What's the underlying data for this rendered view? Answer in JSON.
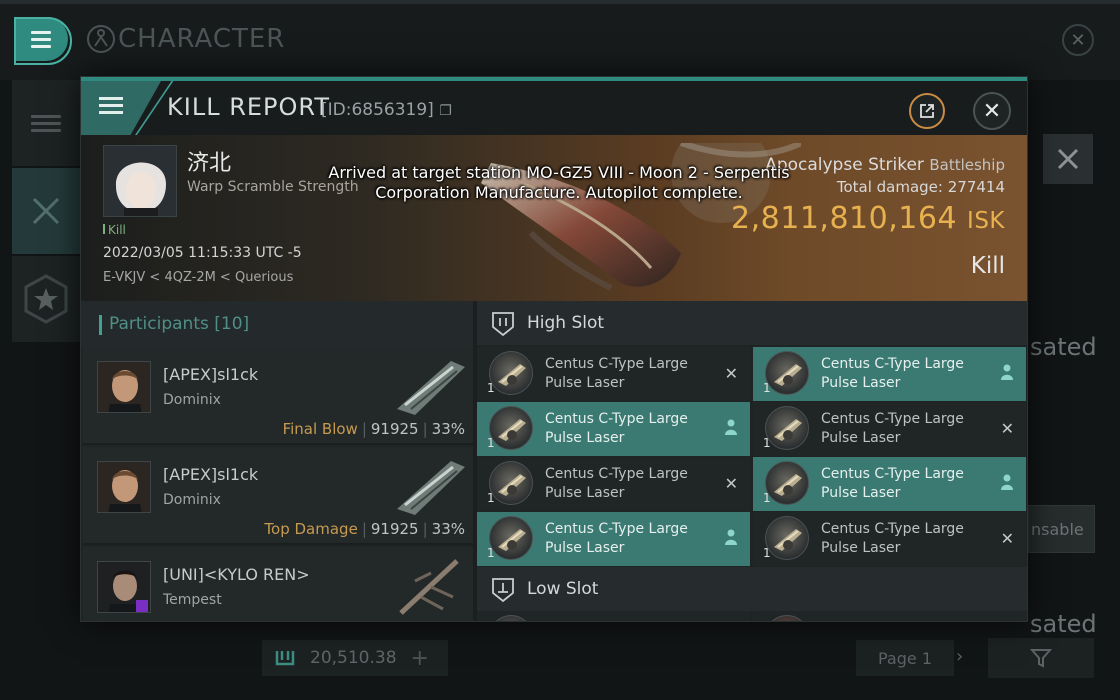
{
  "background": {
    "title": "CHARACTER",
    "right_text_1": "sated",
    "right_text_2": "nsable",
    "right_text_3": "sated",
    "wallet_value": "20,510.38",
    "page_label": "Page 1"
  },
  "kill_report": {
    "title": "KILL REPORT",
    "id_label": "[ID:6856319]",
    "victim": {
      "name": "济北",
      "subtitle": "Warp Scramble Strength",
      "kill_tag": "Kill",
      "date": "2022/03/05 11:15:33 UTC -5",
      "location": "E-VKJV < 4QZ-2M < Querious"
    },
    "ship": {
      "name": "Apocalypse Striker",
      "class": "Battleship",
      "total_damage_label": "Total damage:",
      "total_damage": "277414",
      "isk_value": "2,811,810,164",
      "isk_unit": "ISK",
      "result": "Kill"
    },
    "toast": "Arrived at target station MO-GZ5 VIII - Moon 2 - Serpentis Corporation Manufacture. Autopilot complete.",
    "participants": {
      "title": "Participants [10]",
      "rows": [
        {
          "name": "[APEX]sl1ck",
          "ship": "Dominix",
          "label": "Final Blow",
          "damage": "91925",
          "percent": "33%"
        },
        {
          "name": "[APEX]sl1ck",
          "ship": "Dominix",
          "label": "Top Damage",
          "damage": "91925",
          "percent": "33%"
        },
        {
          "name": "[UNI]<KYLO REN>",
          "ship": "Tempest",
          "label": "",
          "damage": "",
          "percent": ""
        }
      ]
    },
    "fitting": {
      "high_slot_title": "High Slot",
      "low_slot_title": "Low Slot",
      "high_slots": [
        {
          "name": "Centus C-Type Large Pulse Laser",
          "qty": "1",
          "status": "destroyed",
          "highlight": false
        },
        {
          "name": "Centus C-Type Large Pulse Laser",
          "qty": "1",
          "status": "dropped",
          "highlight": true
        },
        {
          "name": "Centus C-Type Large Pulse Laser",
          "qty": "1",
          "status": "dropped",
          "highlight": true
        },
        {
          "name": "Centus C-Type Large Pulse Laser",
          "qty": "1",
          "status": "destroyed",
          "highlight": false
        },
        {
          "name": "Centus C-Type Large Pulse Laser",
          "qty": "1",
          "status": "destroyed",
          "highlight": false
        },
        {
          "name": "Centus C-Type Large Pulse Laser",
          "qty": "1",
          "status": "dropped",
          "highlight": true
        },
        {
          "name": "Centus C-Type Large Pulse Laser",
          "qty": "1",
          "status": "dropped",
          "highlight": true
        },
        {
          "name": "Centus C-Type Large Pulse Laser",
          "qty": "1",
          "status": "destroyed",
          "highlight": false
        }
      ]
    }
  },
  "colors": {
    "accent": "#2f8a80",
    "isk": "#e8b150",
    "highlight_module": "#3a7a72"
  }
}
